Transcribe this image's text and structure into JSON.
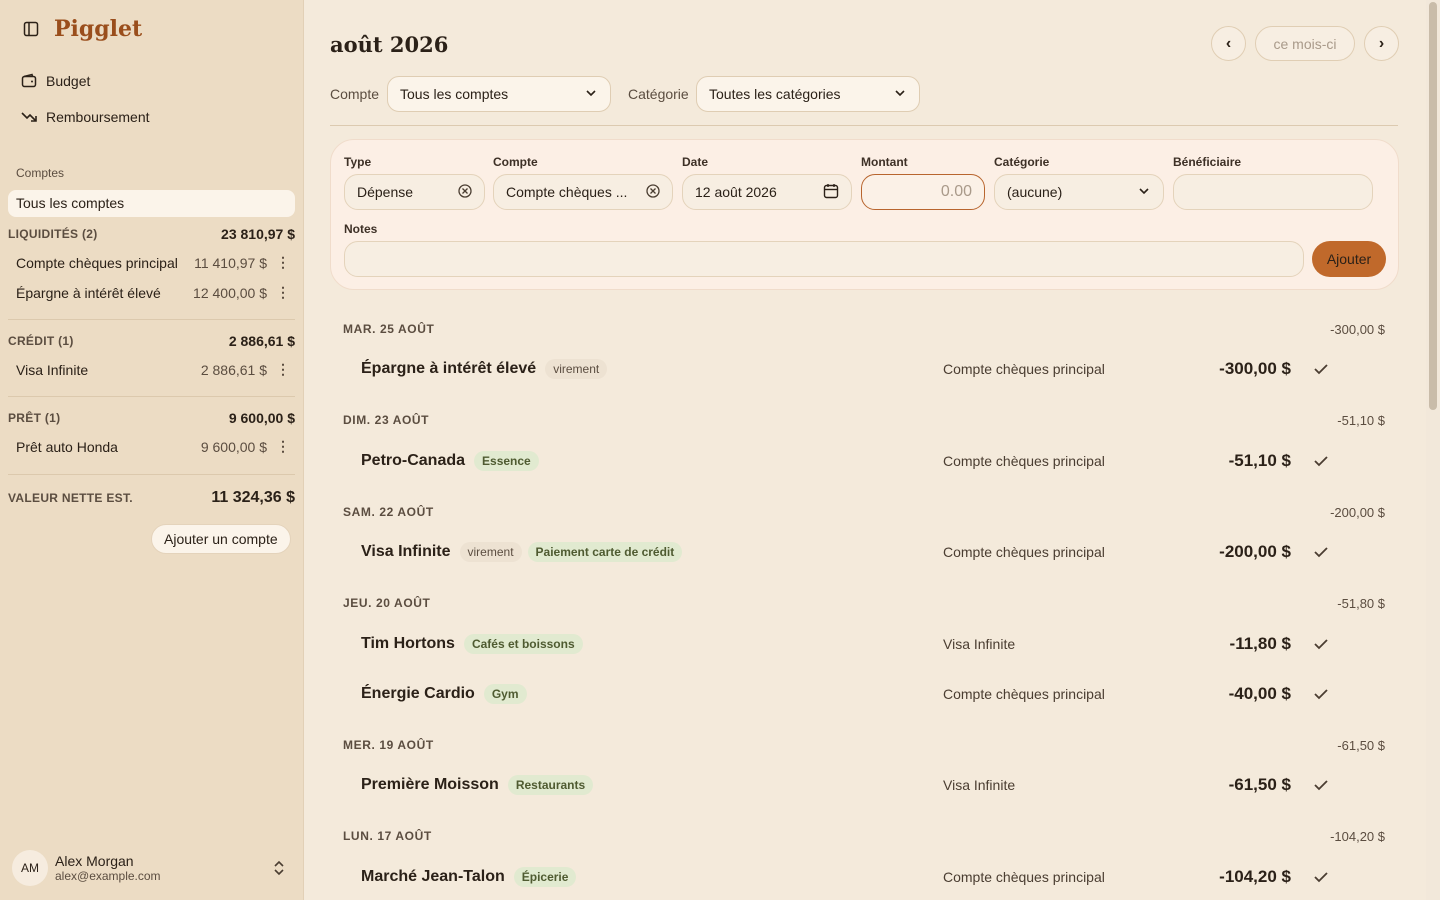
{
  "app": {
    "name": "Pigglet"
  },
  "nav": [
    {
      "label": "Budget",
      "icon": "wallet-icon"
    },
    {
      "label": "Remboursement",
      "icon": "trend-down-icon"
    }
  ],
  "sidebar": {
    "accounts_label": "Comptes",
    "all_accounts": "Tous les comptes",
    "groups": [
      {
        "label": "LIQUIDITÉS (2)",
        "total": "23 810,97 $",
        "accounts": [
          {
            "name": "Compte chèques principal",
            "amount": "11 410,97 $"
          },
          {
            "name": "Épargne à intérêt élevé",
            "amount": "12 400,00 $"
          }
        ]
      },
      {
        "label": "CRÉDIT (1)",
        "total": "2 886,61 $",
        "accounts": [
          {
            "name": "Visa Infinite",
            "amount": "2 886,61 $"
          }
        ]
      },
      {
        "label": "PRÊT (1)",
        "total": "9 600,00 $",
        "accounts": [
          {
            "name": "Prêt auto Honda",
            "amount": "9 600,00 $"
          }
        ]
      }
    ],
    "net_worth_label": "VALEUR NETTE EST.",
    "net_worth": "11 324,36 $",
    "add_account": "Ajouter un compte",
    "user": {
      "initials": "AM",
      "name": "Alex Morgan",
      "email": "alex@example.com"
    }
  },
  "header": {
    "month": "août 2026",
    "prev": "‹",
    "next": "›",
    "this_month": "ce mois-ci"
  },
  "filters": {
    "account_label": "Compte",
    "account_value": "Tous les comptes",
    "category_label": "Catégorie",
    "category_value": "Toutes les catégories"
  },
  "form": {
    "type_label": "Type",
    "type_value": "Dépense",
    "account_label": "Compte",
    "account_value": "Compte chèques ...",
    "date_label": "Date",
    "date_value": "12 août 2026",
    "amount_label": "Montant",
    "amount_placeholder": "0.00",
    "category_label": "Catégorie",
    "category_value": "(aucune)",
    "payee_label": "Bénéficiaire",
    "payee_value": "",
    "notes_label": "Notes",
    "notes_value": "",
    "submit": "Ajouter"
  },
  "days": [
    {
      "label": "MAR. 25 AOÛT",
      "total": "-300,00 $",
      "transactions": [
        {
          "payee": "Épargne à intérêt élevé",
          "tags": [
            {
              "text": "virement",
              "kind": "transfer"
            }
          ],
          "account": "Compte chèques principal",
          "amount": "-300,00 $"
        }
      ]
    },
    {
      "label": "DIM. 23 AOÛT",
      "total": "-51,10 $",
      "transactions": [
        {
          "payee": "Petro-Canada",
          "tags": [
            {
              "text": "Essence",
              "kind": "cat"
            }
          ],
          "account": "Compte chèques principal",
          "amount": "-51,10 $"
        }
      ]
    },
    {
      "label": "SAM. 22 AOÛT",
      "total": "-200,00 $",
      "transactions": [
        {
          "payee": "Visa Infinite",
          "tags": [
            {
              "text": "virement",
              "kind": "transfer"
            },
            {
              "text": "Paiement carte de crédit",
              "kind": "cat"
            }
          ],
          "account": "Compte chèques principal",
          "amount": "-200,00 $"
        }
      ]
    },
    {
      "label": "JEU. 20 AOÛT",
      "total": "-51,80 $",
      "transactions": [
        {
          "payee": "Tim Hortons",
          "tags": [
            {
              "text": "Cafés et boissons",
              "kind": "cat"
            }
          ],
          "account": "Visa Infinite",
          "amount": "-11,80 $"
        },
        {
          "payee": "Énergie Cardio",
          "tags": [
            {
              "text": "Gym",
              "kind": "cat"
            }
          ],
          "account": "Compte chèques principal",
          "amount": "-40,00 $"
        }
      ]
    },
    {
      "label": "MER. 19 AOÛT",
      "total": "-61,50 $",
      "transactions": [
        {
          "payee": "Première Moisson",
          "tags": [
            {
              "text": "Restaurants",
              "kind": "cat"
            }
          ],
          "account": "Visa Infinite",
          "amount": "-61,50 $"
        }
      ]
    },
    {
      "label": "LUN. 17 AOÛT",
      "total": "-104,20 $",
      "transactions": [
        {
          "payee": "Marché Jean-Talon",
          "tags": [
            {
              "text": "Épicerie",
              "kind": "cat"
            }
          ],
          "account": "Compte chèques principal",
          "amount": "-104,20 $"
        }
      ]
    }
  ]
}
